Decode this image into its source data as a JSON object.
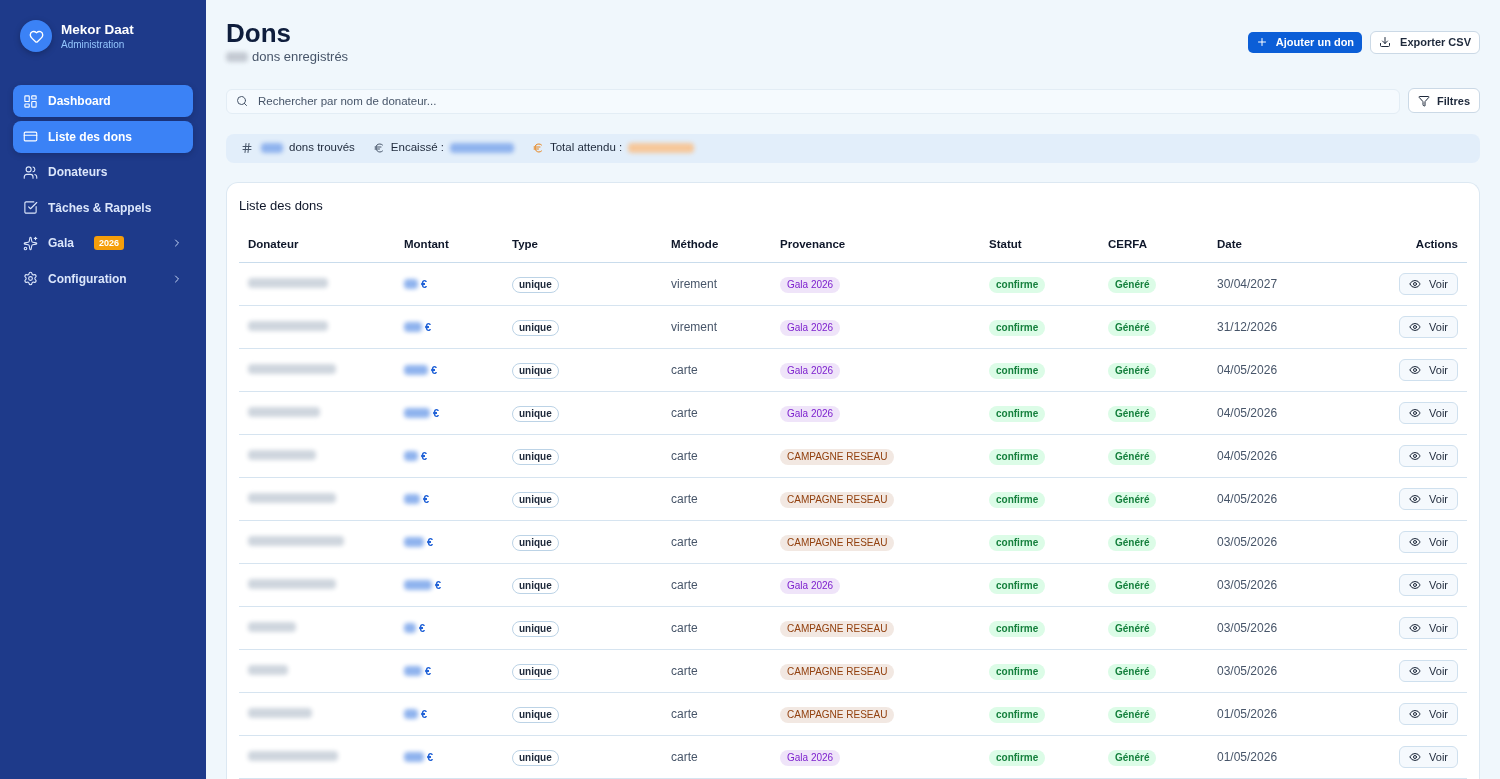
{
  "sidebar": {
    "brand": {
      "name": "Mekor Daat",
      "subtitle": "Administration"
    },
    "items": [
      {
        "label": "Dashboard",
        "selected": true,
        "expandable": false
      },
      {
        "label": "Liste des dons",
        "selected": true,
        "expandable": false
      },
      {
        "label": "Donateurs",
        "selected": false,
        "expandable": false
      },
      {
        "label": "Tâches & Rappels",
        "selected": false,
        "expandable": false
      },
      {
        "label": "Gala",
        "badge": "2026",
        "selected": false,
        "expandable": true
      },
      {
        "label": "Configuration",
        "selected": false,
        "expandable": true
      }
    ]
  },
  "header": {
    "title": "Dons",
    "subtitle": "dons enregistrés",
    "actions": [
      {
        "label": "Ajouter un don",
        "kind": "primary"
      },
      {
        "label": "Exporter CSV",
        "kind": "export"
      }
    ]
  },
  "search": {
    "placeholder": "Rechercher par nom de donateur...",
    "filter_button": "Filtres"
  },
  "stats": [
    {
      "kind": "count",
      "label": "dons trouvés"
    },
    {
      "kind": "collected",
      "label": "Encaissé :"
    },
    {
      "kind": "expected",
      "label": "Total attendu :"
    }
  ],
  "table": {
    "title": "Liste des dons",
    "columns": [
      "Donateur",
      "Montant",
      "Type",
      "Méthode",
      "Provenance",
      "Statut",
      "CERFA",
      "Date",
      "Actions"
    ],
    "rows": [
      {
        "currency": "€",
        "type": "unique",
        "method": "virement",
        "source": {
          "label": "Gala 2026",
          "color": "#7e22ce"
        },
        "status": "confirme",
        "cerfa": "Généré",
        "date": "30/04/2027",
        "action": "Voir"
      },
      {
        "currency": "€",
        "type": "unique",
        "method": "virement",
        "source": {
          "label": "Gala 2026",
          "color": "#7e22ce"
        },
        "status": "confirme",
        "cerfa": "Généré",
        "date": "31/12/2026",
        "action": "Voir"
      },
      {
        "currency": "€",
        "type": "unique",
        "method": "carte",
        "source": {
          "label": "Gala 2026",
          "color": "#7e22ce"
        },
        "status": "confirme",
        "cerfa": "Généré",
        "date": "04/05/2026",
        "action": "Voir"
      },
      {
        "currency": "€",
        "type": "unique",
        "method": "carte",
        "source": {
          "label": "Gala 2026",
          "color": "#7e22ce"
        },
        "status": "confirme",
        "cerfa": "Généré",
        "date": "04/05/2026",
        "action": "Voir"
      },
      {
        "currency": "€",
        "type": "unique",
        "method": "carte",
        "source": {
          "label": "CAMPAGNE RESEAU",
          "color": "#92400e"
        },
        "status": "confirme",
        "cerfa": "Généré",
        "date": "04/05/2026",
        "action": "Voir"
      },
      {
        "currency": "€",
        "type": "unique",
        "method": "carte",
        "source": {
          "label": "CAMPAGNE RESEAU",
          "color": "#92400e"
        },
        "status": "confirme",
        "cerfa": "Généré",
        "date": "04/05/2026",
        "action": "Voir"
      },
      {
        "currency": "€",
        "type": "unique",
        "method": "carte",
        "source": {
          "label": "CAMPAGNE RESEAU",
          "color": "#92400e"
        },
        "status": "confirme",
        "cerfa": "Généré",
        "date": "03/05/2026",
        "action": "Voir"
      },
      {
        "currency": "€",
        "type": "unique",
        "method": "carte",
        "source": {
          "label": "Gala 2026",
          "color": "#7e22ce"
        },
        "status": "confirme",
        "cerfa": "Généré",
        "date": "03/05/2026",
        "action": "Voir"
      },
      {
        "currency": "€",
        "type": "unique",
        "method": "carte",
        "source": {
          "label": "CAMPAGNE RESEAU",
          "color": "#92400e"
        },
        "status": "confirme",
        "cerfa": "Généré",
        "date": "03/05/2026",
        "action": "Voir"
      },
      {
        "currency": "€",
        "type": "unique",
        "method": "carte",
        "source": {
          "label": "CAMPAGNE RESEAU",
          "color": "#92400e"
        },
        "status": "confirme",
        "cerfa": "Généré",
        "date": "03/05/2026",
        "action": "Voir"
      },
      {
        "currency": "€",
        "type": "unique",
        "method": "carte",
        "source": {
          "label": "CAMPAGNE RESEAU",
          "color": "#92400e"
        },
        "status": "confirme",
        "cerfa": "Généré",
        "date": "01/05/2026",
        "action": "Voir"
      },
      {
        "currency": "€",
        "type": "unique",
        "method": "carte",
        "source": {
          "label": "Gala 2026",
          "color": "#7e22ce"
        },
        "status": "confirme",
        "cerfa": "Généré",
        "date": "01/05/2026",
        "action": "Voir"
      }
    ]
  }
}
